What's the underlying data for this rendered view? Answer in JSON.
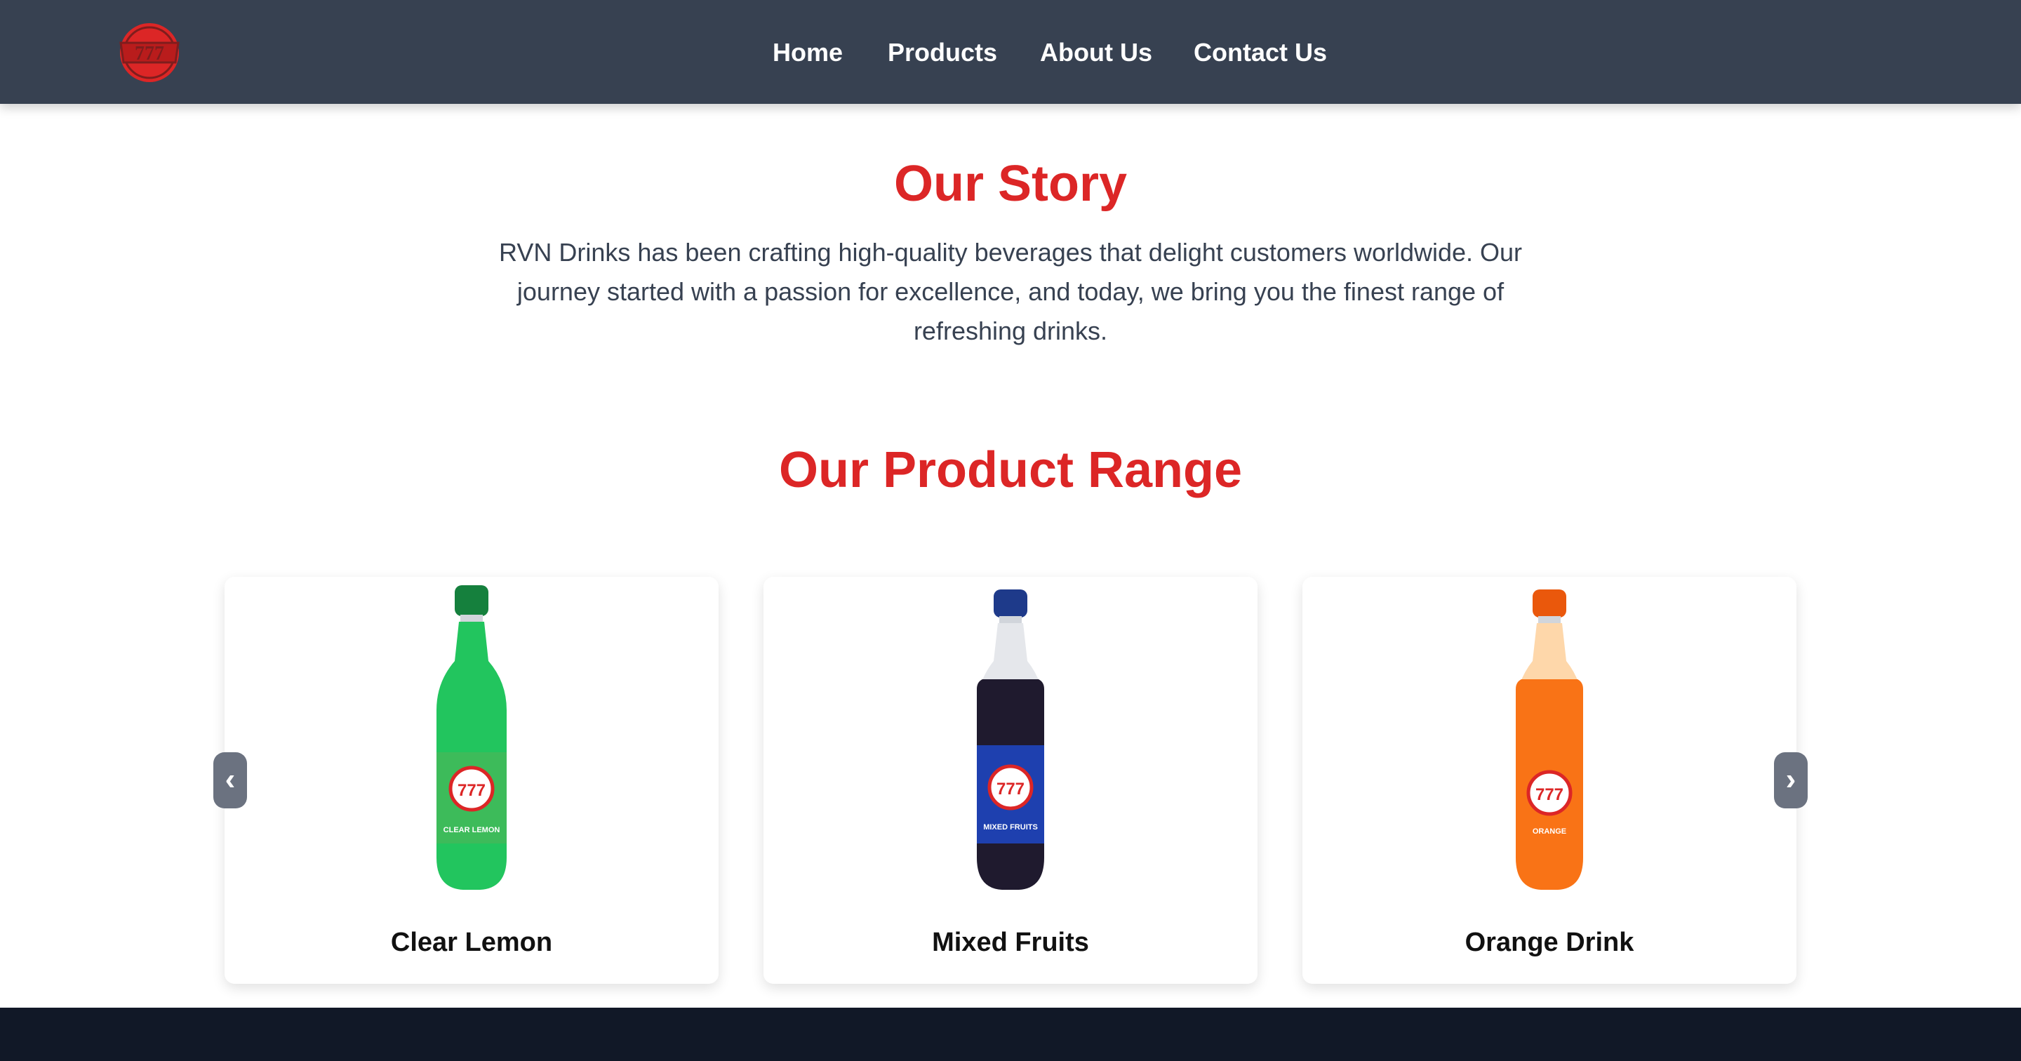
{
  "nav": {
    "logo_icon": "triple-seven-logo-icon",
    "links": [
      "Home",
      "Products",
      "About Us",
      "Contact Us"
    ]
  },
  "story": {
    "title": "Our Story",
    "text": "RVN Drinks has been crafting high-quality beverages that delight customers worldwide. Our journey started with a passion for excellence, and today, we bring you the finest range of refreshing drinks."
  },
  "products": {
    "title": "Our Product Range",
    "items": [
      {
        "name": "Clear Lemon",
        "cap_color": "#15803d",
        "liquid_color": "#22c55e",
        "label_color": "#3dbb5a",
        "label_text": "CLEAR LEMON",
        "brand_text": "777"
      },
      {
        "name": "Mixed Fruits",
        "cap_color": "#1e3a8a",
        "liquid_color": "#1f1a2e",
        "label_color": "#1e40af",
        "label_text": "MIXED FRUITS",
        "brand_text": "777"
      },
      {
        "name": "Orange Drink",
        "cap_color": "#ea580c",
        "liquid_color": "#f97316",
        "label_color": "#f97316",
        "label_text": "ORANGE",
        "brand_text": "777"
      }
    ],
    "prev_icon": "chevron-left-icon",
    "next_icon": "chevron-right-icon",
    "prev_glyph": "‹",
    "next_glyph": "›"
  },
  "colors": {
    "navbar": "#374151",
    "accent": "#dc2626",
    "footer": "#111827"
  }
}
